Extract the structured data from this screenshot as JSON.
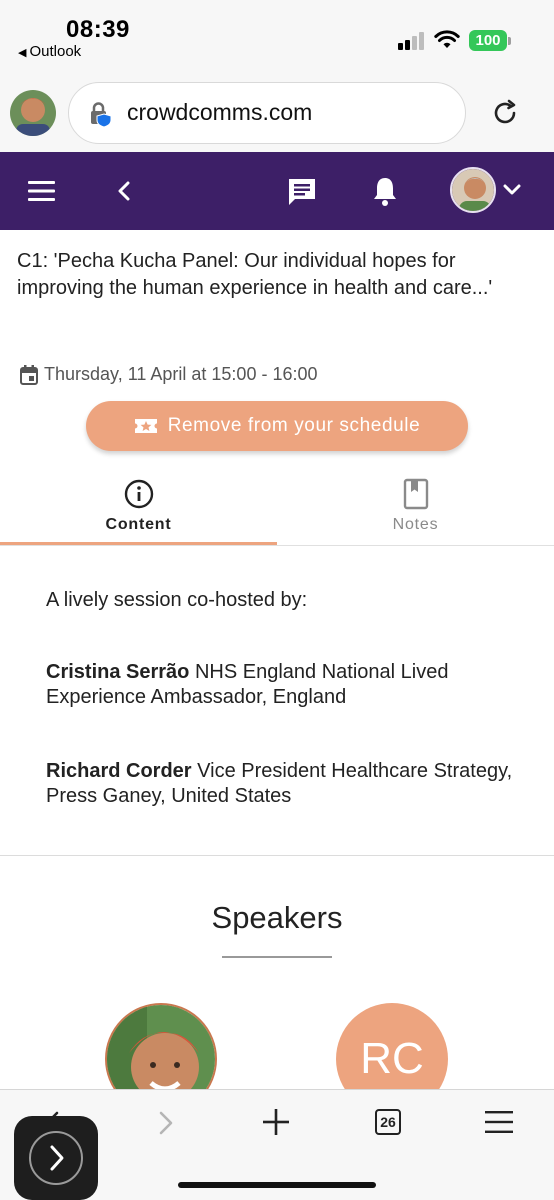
{
  "status_bar": {
    "time": "08:39",
    "back_app": "Outlook",
    "battery": "100",
    "icons": [
      "signal-icon",
      "wifi-icon",
      "battery-icon"
    ]
  },
  "browser": {
    "url": "crowdcomms.com",
    "icons": [
      "profile-avatar",
      "lock-shield-icon",
      "reload-icon"
    ]
  },
  "app_header": {
    "icons": [
      "menu-icon",
      "back-chevron-icon",
      "chat-icon",
      "bell-icon",
      "user-avatar",
      "chevron-down-icon"
    ],
    "color": "#3d1f67"
  },
  "session": {
    "title": "C1: 'Pecha Kucha Panel: Our individual hopes for improving the human experience in health and care...'",
    "date": "Thursday, 11 April at 15:00 - 16:00",
    "schedule_button": "Remove from your schedule",
    "accent_color": "#eda47f"
  },
  "tabs": [
    {
      "label": "Content",
      "icon": "info-icon",
      "active": true
    },
    {
      "label": "Notes",
      "icon": "bookmark-icon",
      "active": false
    }
  ],
  "description": {
    "intro": "A lively session co-hosted by:",
    "hosts": [
      {
        "name": "Cristina Serrão",
        "role": "NHS England National Lived Experience Ambassador, England"
      },
      {
        "name": "Richard Corder",
        "role": "Vice President Healthcare Strategy, Press Ganey, United States"
      }
    ]
  },
  "speakers": {
    "title": "Speakers",
    "initials": "RC"
  },
  "bottom_toolbar": {
    "tab_count": "26",
    "icons": [
      "back-icon",
      "forward-icon",
      "new-tab-icon",
      "tabs-icon",
      "menu-icon"
    ]
  }
}
